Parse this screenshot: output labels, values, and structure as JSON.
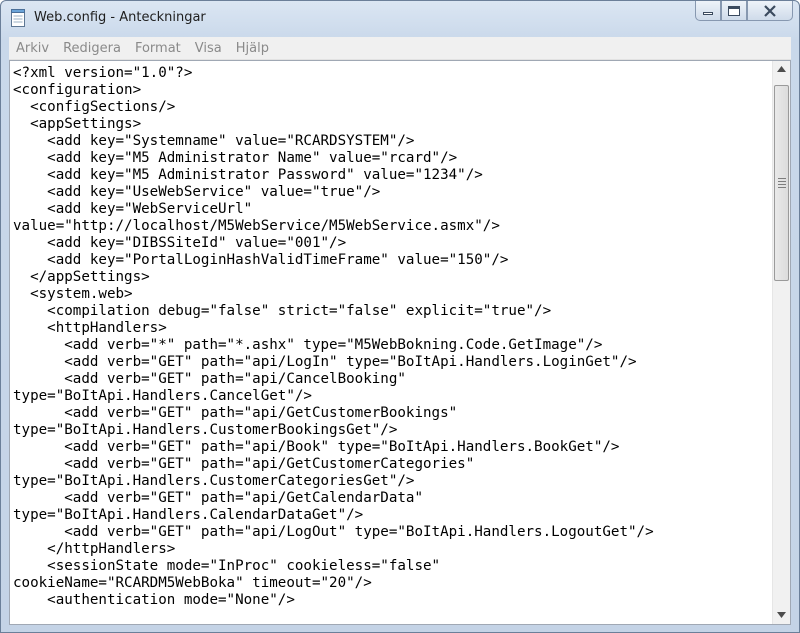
{
  "window": {
    "title": "Web.config - Anteckningar"
  },
  "menu": {
    "items": [
      "Arkiv",
      "Redigera",
      "Format",
      "Visa",
      "Hjälp"
    ]
  },
  "document": {
    "lines": [
      "<?xml version=\"1.0\"?>",
      "<configuration>",
      "  <configSections/>",
      "  <appSettings>",
      "    <add key=\"Systemname\" value=\"RCARDSYSTEM\"/>",
      "    <add key=\"M5 Administrator Name\" value=\"rcard\"/>",
      "    <add key=\"M5 Administrator Password\" value=\"1234\"/>",
      "    <add key=\"UseWebService\" value=\"true\"/>",
      "    <add key=\"WebServiceUrl\"",
      "value=\"http://localhost/M5WebService/M5WebService.asmx\"/>",
      "    <add key=\"DIBSSiteId\" value=\"001\"/>",
      "    <add key=\"PortalLoginHashValidTimeFrame\" value=\"150\"/>",
      "  </appSettings>",
      "  <system.web>",
      "    <compilation debug=\"false\" strict=\"false\" explicit=\"true\"/>",
      "    <httpHandlers>",
      "      <add verb=\"*\" path=\"*.ashx\" type=\"M5WebBokning.Code.GetImage\"/>",
      "      <add verb=\"GET\" path=\"api/LogIn\" type=\"BoItApi.Handlers.LoginGet\"/>",
      "      <add verb=\"GET\" path=\"api/CancelBooking\"",
      "type=\"BoItApi.Handlers.CancelGet\"/>",
      "      <add verb=\"GET\" path=\"api/GetCustomerBookings\"",
      "type=\"BoItApi.Handlers.CustomerBookingsGet\"/>",
      "      <add verb=\"GET\" path=\"api/Book\" type=\"BoItApi.Handlers.BookGet\"/>",
      "      <add verb=\"GET\" path=\"api/GetCustomerCategories\"",
      "type=\"BoItApi.Handlers.CustomerCategoriesGet\"/>",
      "      <add verb=\"GET\" path=\"api/GetCalendarData\"",
      "type=\"BoItApi.Handlers.CalendarDataGet\"/>",
      "      <add verb=\"GET\" path=\"api/LogOut\" type=\"BoItApi.Handlers.LogoutGet\"/>",
      "    </httpHandlers>",
      "    <sessionState mode=\"InProc\" cookieless=\"false\"",
      "cookieName=\"RCARDM5WebBoka\" timeout=\"20\"/>",
      "    <authentication mode=\"None\"/>"
    ]
  },
  "icons": {
    "app": "notepad-icon",
    "minimize": "minimize-icon",
    "maximize": "maximize-icon",
    "close": "close-icon",
    "scroll_up": "arrow-up-icon",
    "scroll_down": "arrow-down-icon"
  }
}
